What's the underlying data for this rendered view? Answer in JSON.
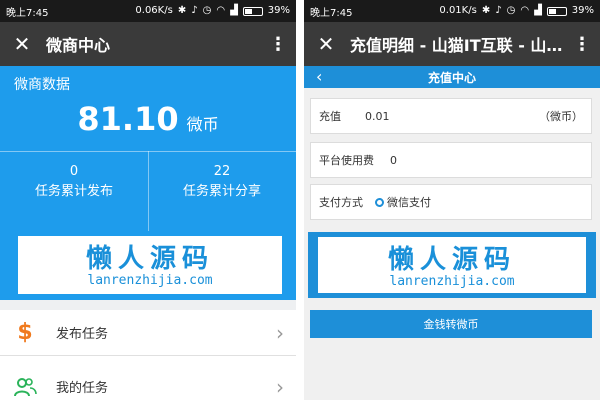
{
  "left": {
    "status": {
      "time": "晚上7:45",
      "speed": "0.06K/s",
      "battery": "39%"
    },
    "titlebar": {
      "title": "微商中心"
    },
    "stats": {
      "label": "微商数据",
      "amount": "81.10",
      "unit": "微币",
      "published_count": "0",
      "published_label": "任务累计发布",
      "shared_count": "22",
      "shared_label": "任务累计分享"
    },
    "banner": {
      "cn": "懒人源码",
      "en": "lanrenzhijia.com"
    },
    "menu": [
      {
        "label": "发布任务",
        "icon": "dollar-icon",
        "icon_color": "#f07a1e"
      },
      {
        "label": "我的任务",
        "icon": "users-icon",
        "icon_color": "#2bb35a"
      }
    ]
  },
  "right": {
    "status": {
      "time": "晚上7:45",
      "speed": "0.01K/s",
      "battery": "39%"
    },
    "titlebar": {
      "title": "充值明细 - 山猫IT互联 - 山…"
    },
    "subhead": {
      "title": "充值中心"
    },
    "form": {
      "recharge_label": "充值",
      "recharge_value": "0.01",
      "recharge_unit": "（微币）",
      "fee_label": "平台使用费",
      "fee_value": "0",
      "pay_label": "支付方式",
      "pay_option": "微信支付"
    },
    "banner": {
      "cn": "懒人源码",
      "en": "lanrenzhijia.com"
    },
    "convert_button": "金钱转微币"
  },
  "colors": {
    "accent": "#1e9cec",
    "titlebar": "#3a3a3a",
    "statusbar": "#1a1a1a"
  }
}
